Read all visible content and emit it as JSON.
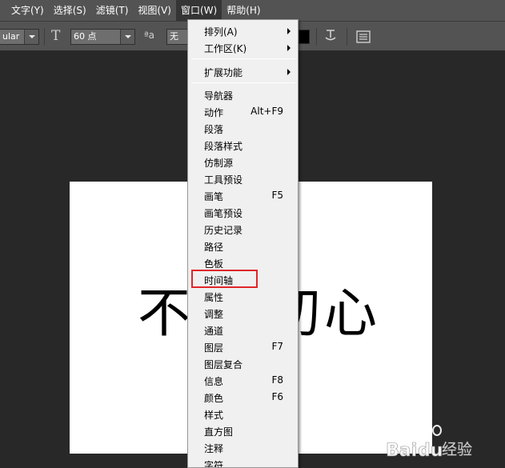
{
  "menubar": {
    "items": [
      {
        "label": "文字(Y)"
      },
      {
        "label": "选择(S)"
      },
      {
        "label": "滤镜(T)"
      },
      {
        "label": "视图(V)"
      },
      {
        "label": "窗口(W)"
      },
      {
        "label": "帮助(H)"
      }
    ],
    "active_index": 4
  },
  "options": {
    "font_style": "ular",
    "font_size": "60 点",
    "antialias": "无",
    "text_size_icon": "text-size-icon",
    "antialias_icon": "aa-icon",
    "warp_icon": "warp-text-icon",
    "panel_icon": "panels-icon",
    "color_swatch": "#000000"
  },
  "canvas": {
    "chars": [
      "不",
      "初",
      "心"
    ]
  },
  "window_menu": {
    "items": [
      {
        "label": "排列(A)",
        "shortcut": "",
        "submenu": true
      },
      {
        "label": "工作区(K)",
        "shortcut": "",
        "submenu": true
      },
      {
        "label": "扩展功能",
        "shortcut": "",
        "submenu": true
      },
      {
        "label": "导航器",
        "shortcut": ""
      },
      {
        "label": "动作",
        "shortcut": "Alt+F9"
      },
      {
        "label": "段落",
        "shortcut": ""
      },
      {
        "label": "段落样式",
        "shortcut": ""
      },
      {
        "label": "仿制源",
        "shortcut": ""
      },
      {
        "label": "工具预设",
        "shortcut": ""
      },
      {
        "label": "画笔",
        "shortcut": "F5"
      },
      {
        "label": "画笔预设",
        "shortcut": ""
      },
      {
        "label": "历史记录",
        "shortcut": ""
      },
      {
        "label": "路径",
        "shortcut": ""
      },
      {
        "label": "色板",
        "shortcut": ""
      },
      {
        "label": "时间轴",
        "shortcut": "",
        "highlighted": true
      },
      {
        "label": "属性",
        "shortcut": ""
      },
      {
        "label": "调整",
        "shortcut": ""
      },
      {
        "label": "通道",
        "shortcut": ""
      },
      {
        "label": "图层",
        "shortcut": "F7"
      },
      {
        "label": "图层复合",
        "shortcut": ""
      },
      {
        "label": "信息",
        "shortcut": "F8"
      },
      {
        "label": "颜色",
        "shortcut": "F6"
      },
      {
        "label": "样式",
        "shortcut": ""
      },
      {
        "label": "直方图",
        "shortcut": ""
      },
      {
        "label": "注释",
        "shortcut": ""
      },
      {
        "label": "字符",
        "shortcut": ""
      }
    ]
  },
  "watermark": {
    "text": "经验"
  }
}
